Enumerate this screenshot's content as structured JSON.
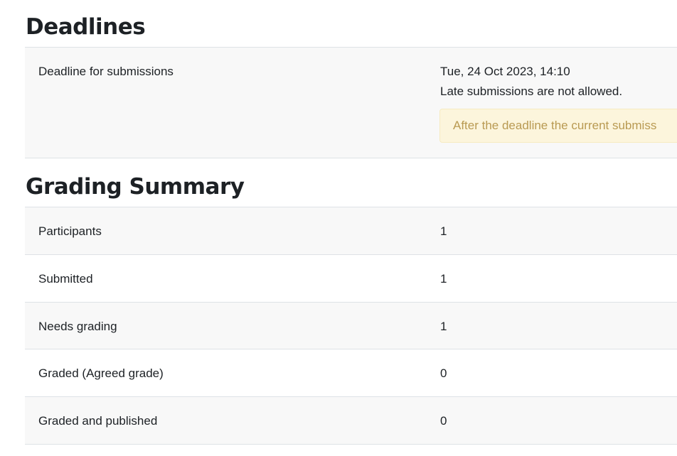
{
  "deadlines": {
    "title": "Deadlines",
    "rows": [
      {
        "label": "Deadline for submissions",
        "value_line1": "Tue, 24 Oct 2023, 14:10",
        "value_line2": "Late submissions are not allowed.",
        "notice": "After the deadline the current submiss"
      }
    ]
  },
  "grading_summary": {
    "title": "Grading Summary",
    "rows": [
      {
        "label": "Participants",
        "value": "1"
      },
      {
        "label": "Submitted",
        "value": "1"
      },
      {
        "label": "Needs grading",
        "value": "1"
      },
      {
        "label": "Graded (Agreed grade)",
        "value": "0"
      },
      {
        "label": "Graded and published",
        "value": "0"
      }
    ]
  }
}
